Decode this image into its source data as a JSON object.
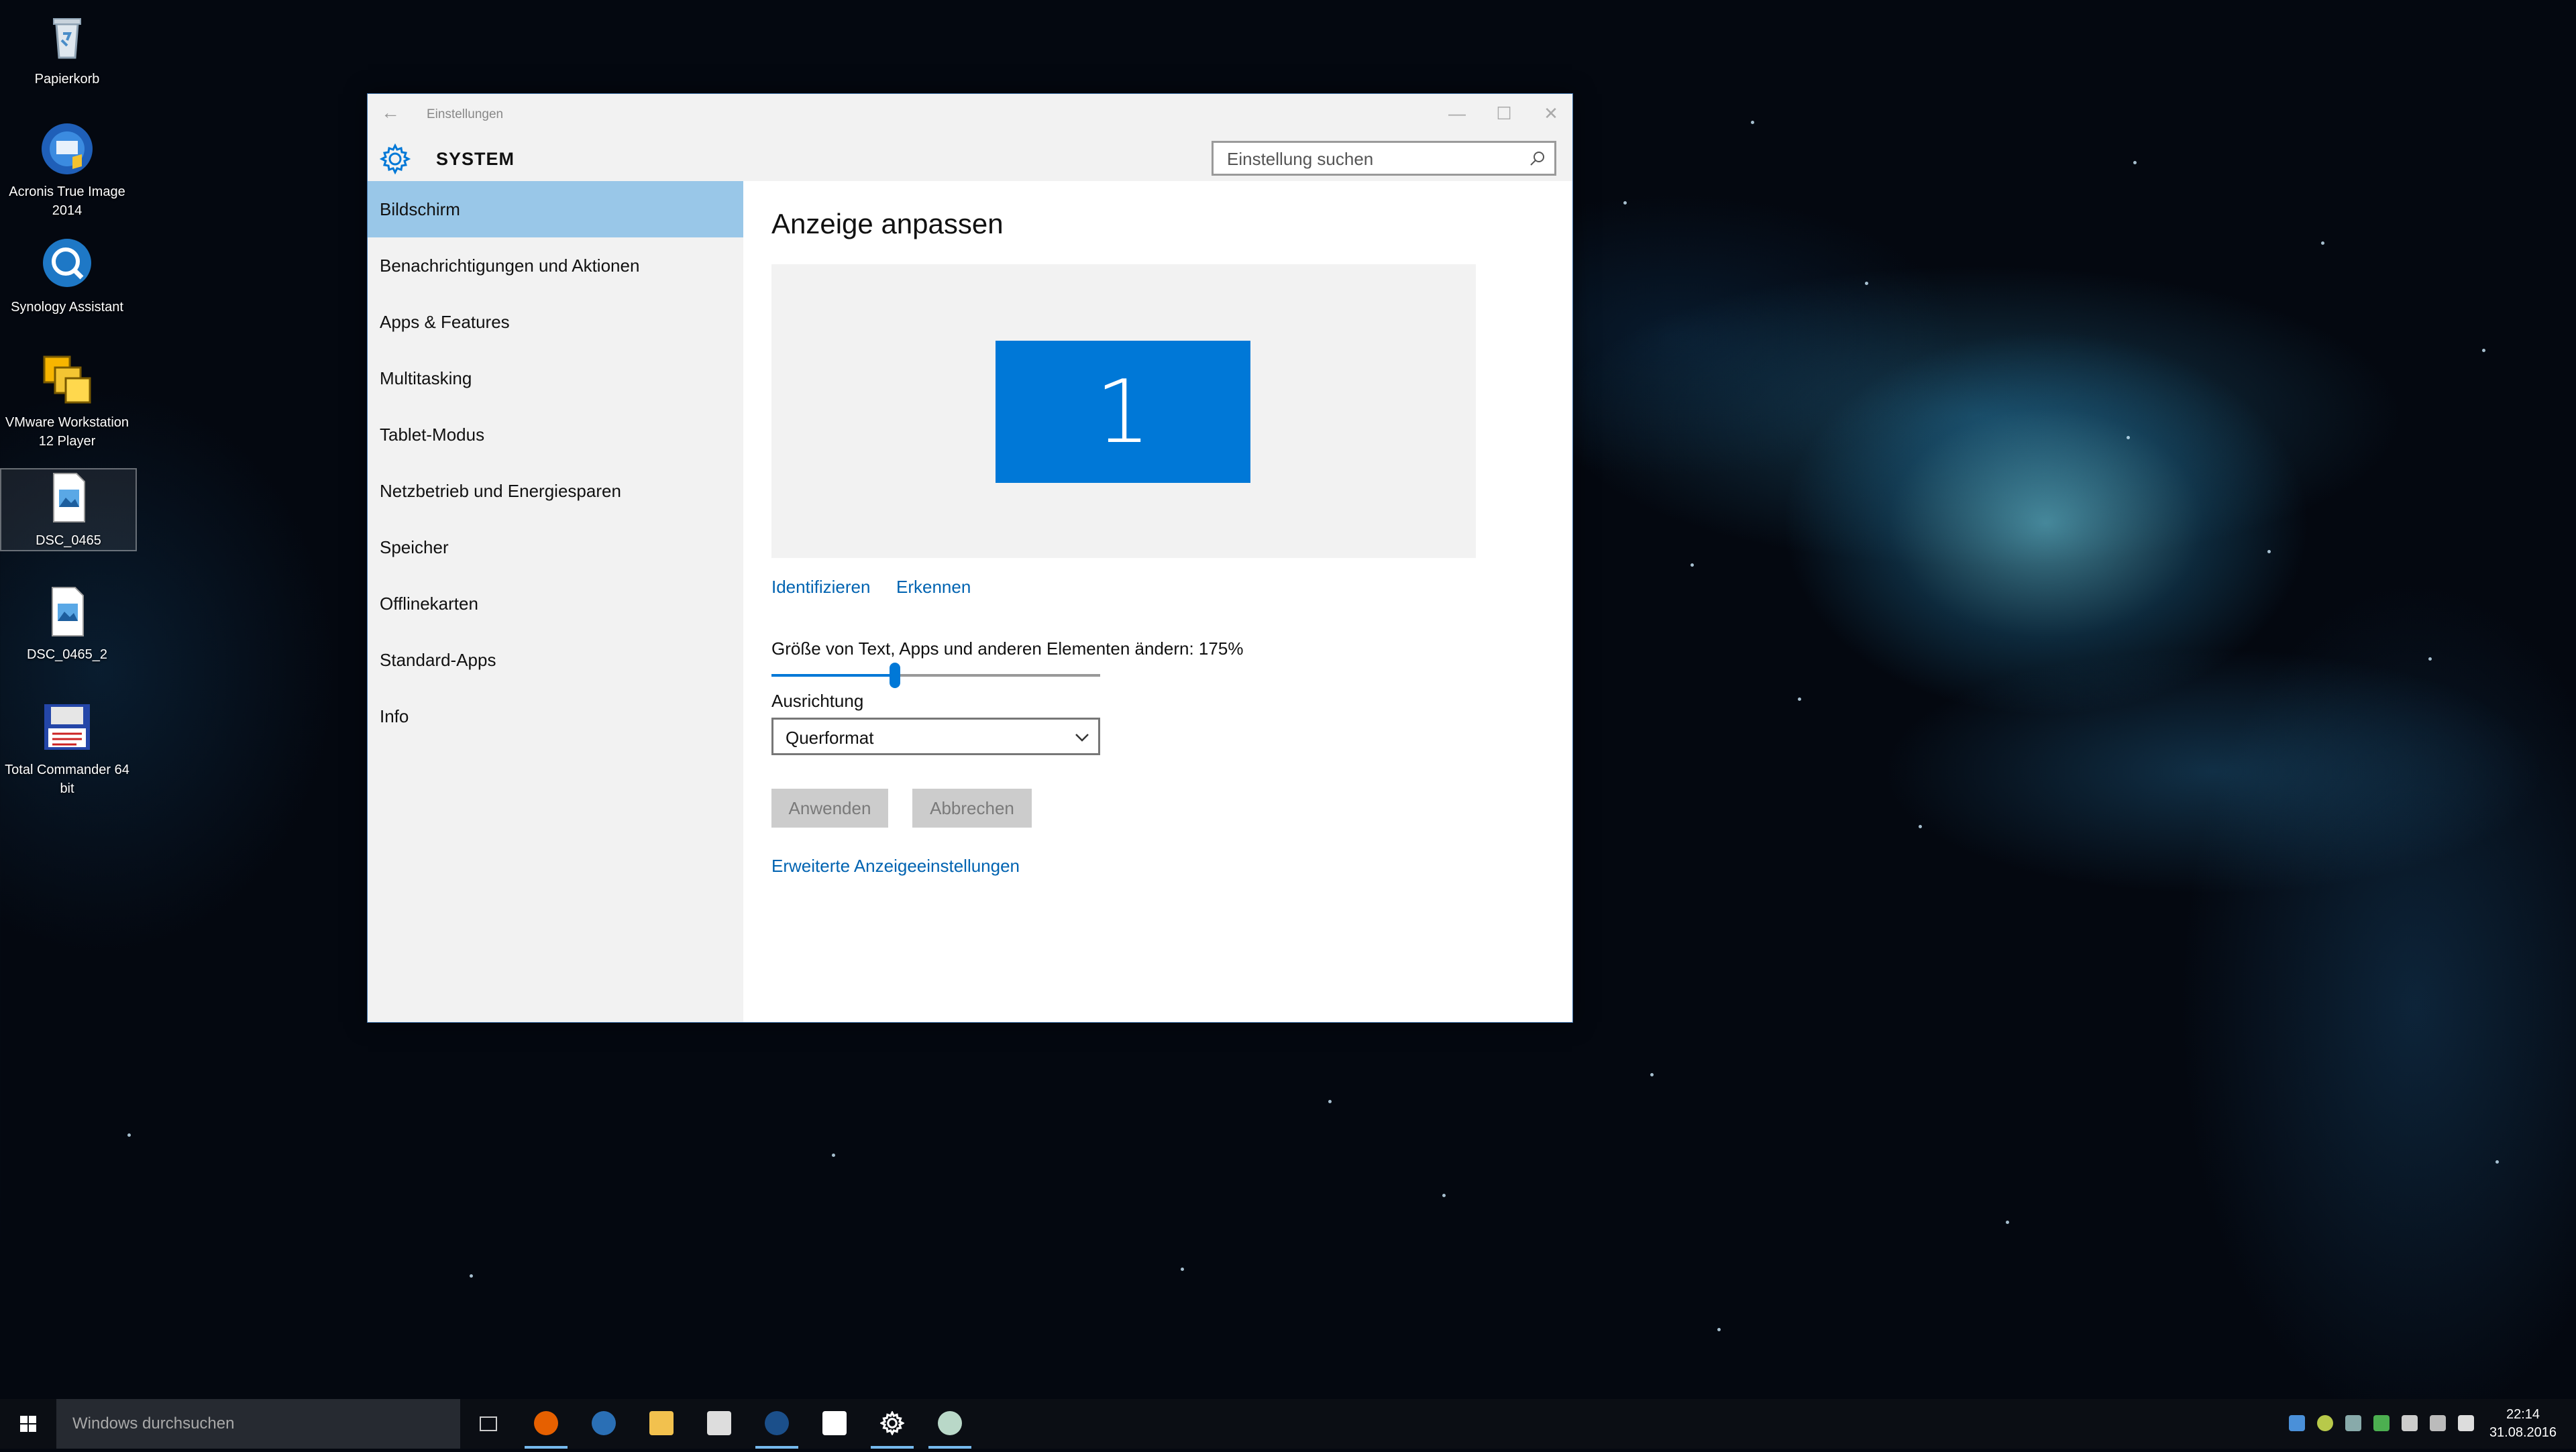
{
  "desktop": {
    "icons": [
      {
        "label": "Papierkorb",
        "icon": "recycle-bin-icon"
      },
      {
        "label": "Acronis True Image 2014",
        "icon": "acronis-icon"
      },
      {
        "label": "Synology Assistant",
        "icon": "synology-icon"
      },
      {
        "label": "VMware Workstation 12 Player",
        "icon": "vmware-icon"
      },
      {
        "label": "DSC_0465",
        "icon": "image-file-icon"
      },
      {
        "label": "DSC_0465_2",
        "icon": "image-file-icon"
      },
      {
        "label": "Total Commander 64 bit",
        "icon": "total-commander-icon"
      }
    ]
  },
  "window": {
    "title": "Einstellungen",
    "section": "SYSTEM",
    "search_placeholder": "Einstellung suchen",
    "controls": {
      "minimize": "—",
      "maximize": "☐",
      "close": "✕"
    },
    "back": "←"
  },
  "sidebar": {
    "items": [
      {
        "label": "Bildschirm",
        "active": true
      },
      {
        "label": "Benachrichtigungen und Aktionen"
      },
      {
        "label": "Apps & Features"
      },
      {
        "label": "Multitasking"
      },
      {
        "label": "Tablet-Modus"
      },
      {
        "label": "Netzbetrieb und Energiesparen"
      },
      {
        "label": "Speicher"
      },
      {
        "label": "Offlinekarten"
      },
      {
        "label": "Standard-Apps"
      },
      {
        "label": "Info"
      }
    ]
  },
  "main": {
    "heading": "Anzeige anpassen",
    "monitor_number": "1",
    "link_identify": "Identifizieren",
    "link_detect": "Erkennen",
    "scale_label": "Größe von Text, Apps und anderen Elementen ändern: 175%",
    "scale_slider_fraction": 0.375,
    "orientation_label": "Ausrichtung",
    "orientation_value": "Querformat",
    "apply_button": "Anwenden",
    "cancel_button": "Abbrechen",
    "advanced_link": "Erweiterte Anzeigeeinstellungen"
  },
  "taskbar": {
    "search_placeholder": "Windows durchsuchen",
    "time": "22:14",
    "date": "31.08.2016"
  },
  "colors": {
    "accent": "#0078d7",
    "link": "#0063b1",
    "nav_active": "#99c7e8"
  }
}
